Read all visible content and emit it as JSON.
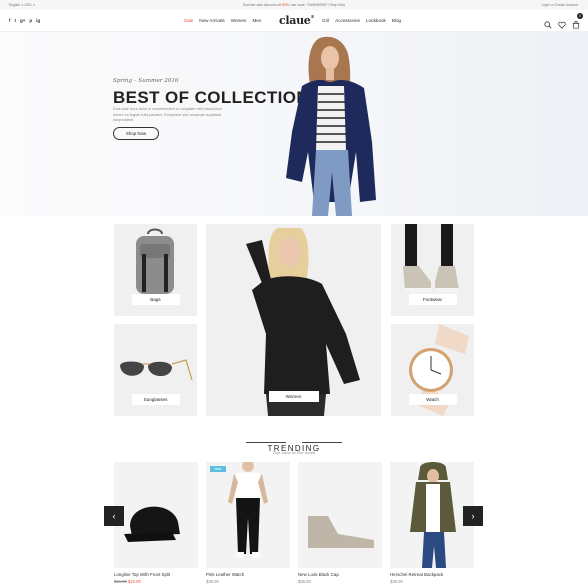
{
  "topbar": {
    "lang": "English ∨  USD ∨",
    "promo_before": "Summer sale discount off ",
    "promo_highlight": "50%",
    "promo_after": "! use code: \"SUMMER50\"! Shop Now",
    "account": "Login or Create Account"
  },
  "header": {
    "social": [
      "f",
      "t",
      "g+",
      "p",
      "ig"
    ],
    "logo": "claue",
    "logo_mark": "®",
    "nav_left": [
      "Sale",
      "New Arrivals",
      "Women",
      "Men"
    ],
    "nav_right": [
      "Girl",
      "Accessories",
      "Lookbook",
      "Blog"
    ],
    "cart_count": "0",
    "icons": [
      "search-icon",
      "heart-icon",
      "cart-icon"
    ]
  },
  "hero": {
    "subtitle": "Spring – Summer 2016",
    "title": "BEST OF COLLECTION!",
    "description": "Duis aute irure dolor in reprehenderit in voluptate velit essecillum dolore eu fugiat nulla pariatur. Excepteur sint occaecat cupidatat nonproident.",
    "button": "Shop Now"
  },
  "categories": {
    "bags": "Bags",
    "women": "Women",
    "footwear": "Footwear",
    "sunglasses": "Sunglasses",
    "watch": "Watch"
  },
  "trending": {
    "title": "TRENDING",
    "subtitle": "Top view in the week",
    "badge_new": "New",
    "products": [
      {
        "name": "Longline Top With Front Split",
        "old_price": "$16.00",
        "price": "$10.00"
      },
      {
        "name": "Pink Leather Watch",
        "price": "$35.00"
      },
      {
        "name": "New Look Black Cap",
        "price": "$35.00"
      },
      {
        "name": "Herschel Retreat Backpack",
        "price": "$35.00"
      }
    ],
    "prev": "‹",
    "next": "›"
  },
  "colors": {
    "accent": "#e8503a",
    "dark": "#222222",
    "badge": "#5bc0de",
    "hero_cardigan": "#1f2a5c"
  }
}
